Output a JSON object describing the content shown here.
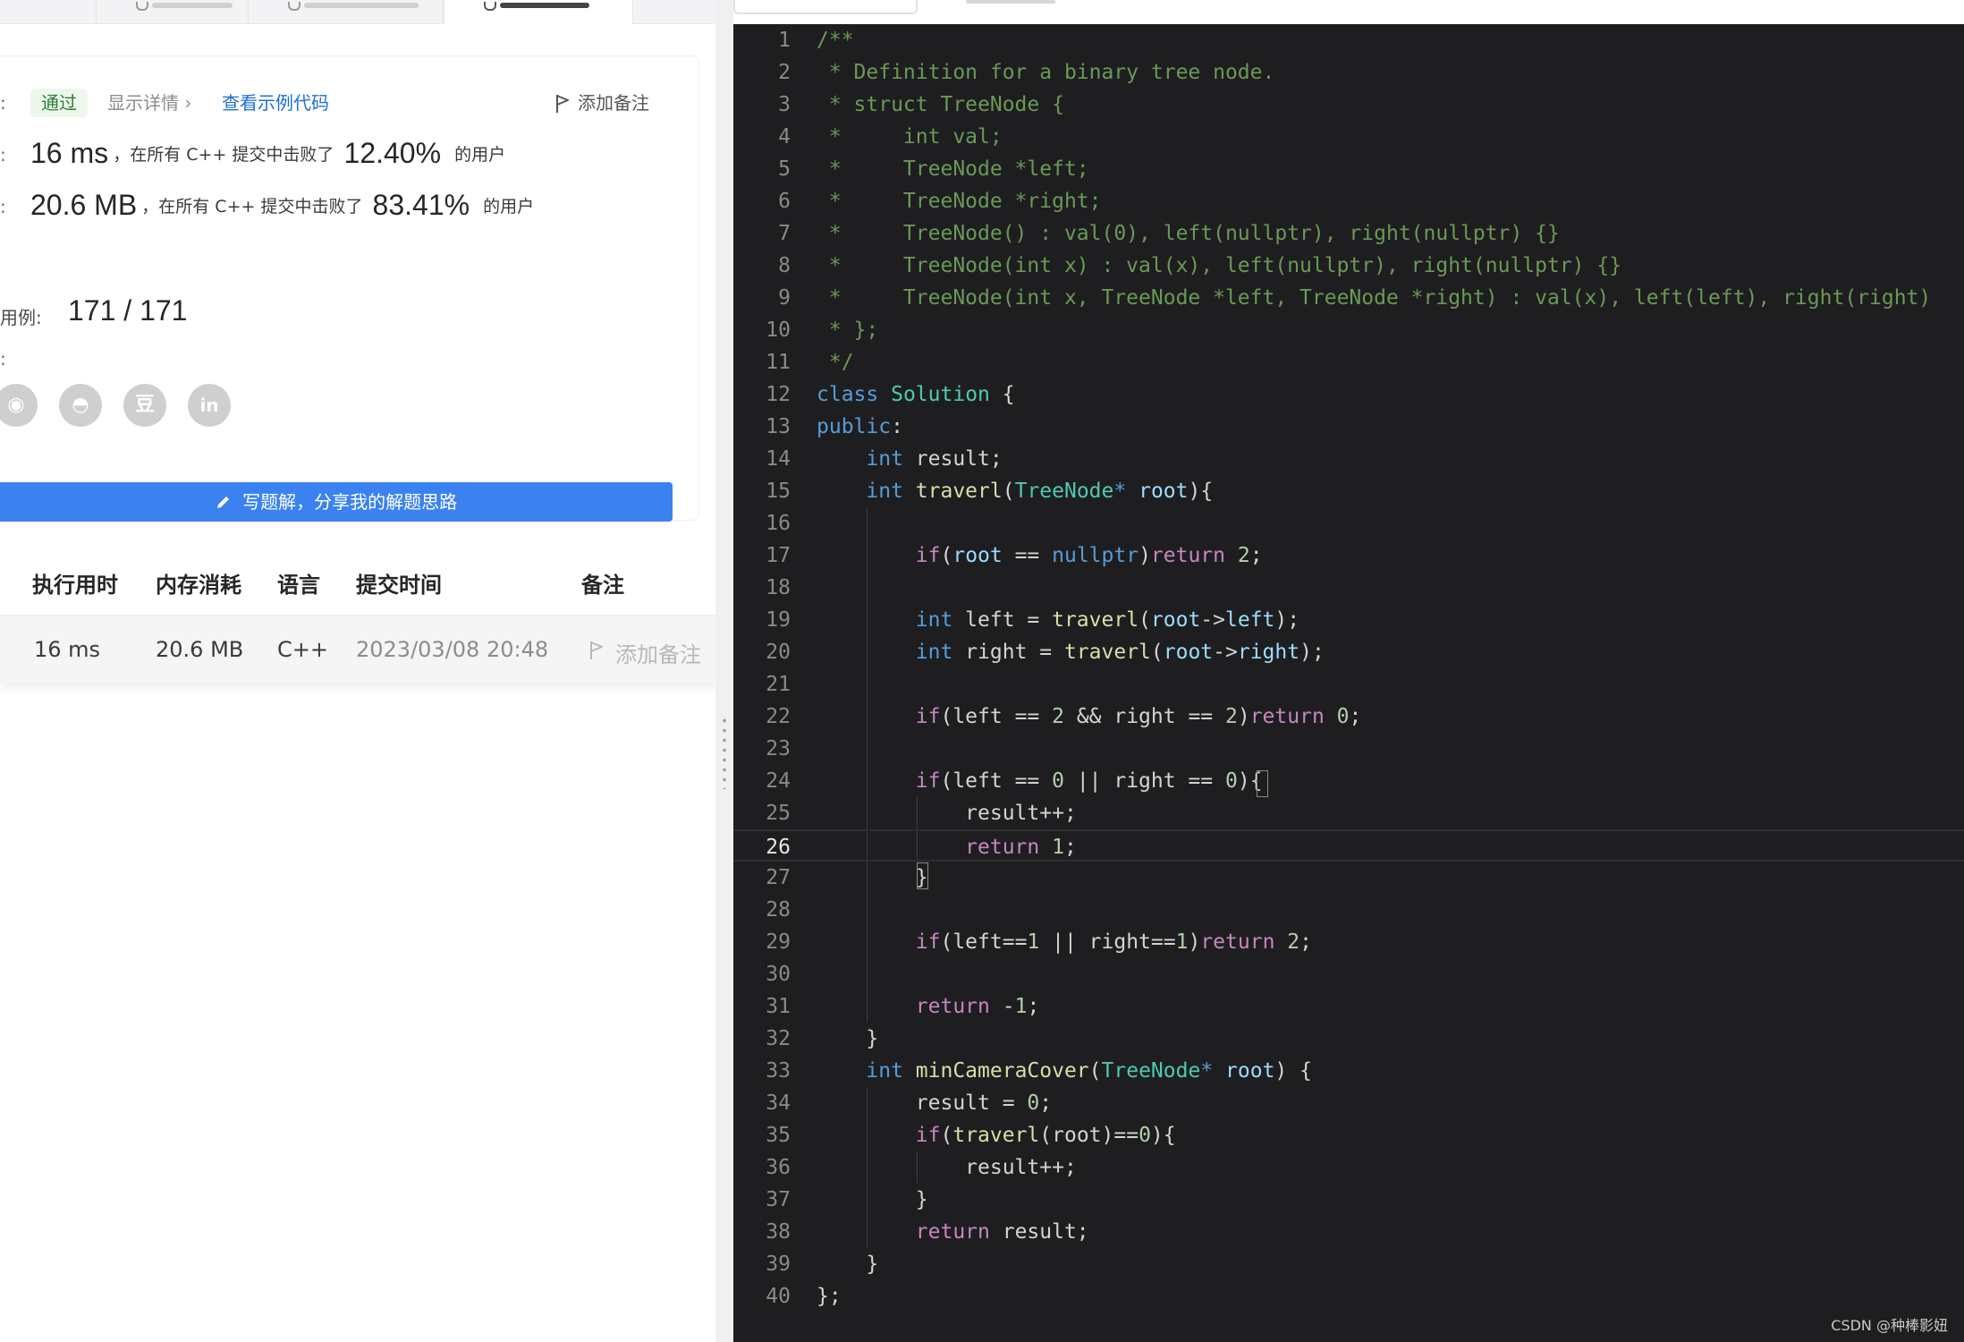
{
  "result": {
    "status_badge": "通过",
    "detail_link": "显示详情 ›",
    "sample_link": "查看示例代码",
    "add_note": "添加备注",
    "runtime": {
      "value": "16 ms",
      "text": "，在所有 C++ 提交中击败了",
      "percent": "12.40%",
      "suffix": "的用户"
    },
    "memory": {
      "value": "20.6 MB",
      "text": "，在所有 C++ 提交中击败了",
      "percent": "83.41%",
      "suffix": "的用户"
    },
    "cases_label": "用例:",
    "cases_value": "171 / 171",
    "share_icons": [
      "weibo-icon",
      "qq-icon",
      "douban-icon",
      "linkedin-icon"
    ],
    "share_glyphs": [
      "◉",
      "◓",
      "豆",
      "in"
    ],
    "write_solution_button": "写题解，分享我的解题思路"
  },
  "submissions": {
    "headers": [
      "执行用时",
      "内存消耗",
      "语言",
      "提交时间",
      "备注"
    ],
    "rows": [
      {
        "runtime": "16 ms",
        "memory": "20.6 MB",
        "language": "C++",
        "time": "2023/03/08 20:48",
        "note": "添加备注"
      }
    ]
  },
  "editor": {
    "lines": [
      [
        [
          "c",
          "/**"
        ]
      ],
      [
        [
          "c",
          " * Definition for a binary tree node."
        ]
      ],
      [
        [
          "c",
          " * struct TreeNode {"
        ]
      ],
      [
        [
          "c",
          " *     int val;"
        ]
      ],
      [
        [
          "c",
          " *     TreeNode *left;"
        ]
      ],
      [
        [
          "c",
          " *     TreeNode *right;"
        ]
      ],
      [
        [
          "c",
          " *     TreeNode() : val(0), left(nullptr), right(nullptr) {}"
        ]
      ],
      [
        [
          "c",
          " *     TreeNode(int x) : val(x), left(nullptr), right(nullptr) {}"
        ]
      ],
      [
        [
          "c",
          " *     TreeNode(int x, TreeNode *left, TreeNode *right) : val(x), left(left), right(right)"
        ]
      ],
      [
        [
          "c",
          " * };"
        ]
      ],
      [
        [
          "c",
          " */"
        ]
      ],
      [
        [
          "t",
          "class"
        ],
        [
          "o",
          " "
        ],
        [
          "k",
          "Solution"
        ],
        [
          "o",
          " {"
        ]
      ],
      [
        [
          "t",
          "public"
        ],
        [
          "o",
          ":"
        ]
      ],
      [
        [
          "o",
          "    "
        ],
        [
          "t",
          "int"
        ],
        [
          "o",
          " result;"
        ]
      ],
      [
        [
          "o",
          "    "
        ],
        [
          "t",
          "int"
        ],
        [
          "o",
          " "
        ],
        [
          "f",
          "traverl"
        ],
        [
          "o",
          "("
        ],
        [
          "k",
          "TreeNode"
        ],
        [
          "t",
          "*"
        ],
        [
          "o",
          " "
        ],
        [
          "v",
          "root"
        ],
        [
          "o",
          "){"
        ]
      ],
      [],
      [
        [
          "o",
          "        "
        ],
        [
          "w",
          "if"
        ],
        [
          "o",
          "("
        ],
        [
          "v",
          "root"
        ],
        [
          "o",
          " == "
        ],
        [
          "t",
          "nullptr"
        ],
        [
          "o",
          ")"
        ],
        [
          "w",
          "return"
        ],
        [
          "o",
          " "
        ],
        [
          "n",
          "2"
        ],
        [
          "o",
          ";"
        ]
      ],
      [],
      [
        [
          "o",
          "        "
        ],
        [
          "t",
          "int"
        ],
        [
          "o",
          " left = "
        ],
        [
          "f",
          "traverl"
        ],
        [
          "o",
          "("
        ],
        [
          "v",
          "root"
        ],
        [
          "o",
          "->"
        ],
        [
          "v",
          "left"
        ],
        [
          "o",
          ");"
        ]
      ],
      [
        [
          "o",
          "        "
        ],
        [
          "t",
          "int"
        ],
        [
          "o",
          " right = "
        ],
        [
          "f",
          "traverl"
        ],
        [
          "o",
          "("
        ],
        [
          "v",
          "root"
        ],
        [
          "o",
          "->"
        ],
        [
          "v",
          "right"
        ],
        [
          "o",
          ");"
        ]
      ],
      [],
      [
        [
          "o",
          "        "
        ],
        [
          "w",
          "if"
        ],
        [
          "o",
          "(left == "
        ],
        [
          "n",
          "2"
        ],
        [
          "o",
          " && right == "
        ],
        [
          "n",
          "2"
        ],
        [
          "o",
          ")"
        ],
        [
          "w",
          "return"
        ],
        [
          "o",
          " "
        ],
        [
          "n",
          "0"
        ],
        [
          "o",
          ";"
        ]
      ],
      [],
      [
        [
          "o",
          "        "
        ],
        [
          "w",
          "if"
        ],
        [
          "o",
          "(left == "
        ],
        [
          "n",
          "0"
        ],
        [
          "o",
          " || right == "
        ],
        [
          "n",
          "0"
        ],
        [
          "o",
          "){"
        ]
      ],
      [
        [
          "o",
          "            result++;"
        ]
      ],
      [
        [
          "o",
          "            "
        ],
        [
          "w",
          "return"
        ],
        [
          "o",
          " "
        ],
        [
          "n",
          "1"
        ],
        [
          "o",
          ";"
        ]
      ],
      [
        [
          "o",
          "        }"
        ]
      ],
      [],
      [
        [
          "o",
          "        "
        ],
        [
          "w",
          "if"
        ],
        [
          "o",
          "(left=="
        ],
        [
          "n",
          "1"
        ],
        [
          "o",
          " || right=="
        ],
        [
          "n",
          "1"
        ],
        [
          "o",
          ")"
        ],
        [
          "w",
          "return"
        ],
        [
          "o",
          " "
        ],
        [
          "n",
          "2"
        ],
        [
          "o",
          ";"
        ]
      ],
      [],
      [
        [
          "o",
          "        "
        ],
        [
          "w",
          "return"
        ],
        [
          "o",
          " -"
        ],
        [
          "n",
          "1"
        ],
        [
          "o",
          ";"
        ]
      ],
      [
        [
          "o",
          "    }"
        ]
      ],
      [
        [
          "o",
          "    "
        ],
        [
          "t",
          "int"
        ],
        [
          "o",
          " "
        ],
        [
          "f",
          "minCameraCover"
        ],
        [
          "o",
          "("
        ],
        [
          "k",
          "TreeNode"
        ],
        [
          "t",
          "*"
        ],
        [
          "o",
          " "
        ],
        [
          "v",
          "root"
        ],
        [
          "o",
          ") {"
        ]
      ],
      [
        [
          "o",
          "        result = "
        ],
        [
          "n",
          "0"
        ],
        [
          "o",
          ";"
        ]
      ],
      [
        [
          "o",
          "        "
        ],
        [
          "w",
          "if"
        ],
        [
          "o",
          "("
        ],
        [
          "f",
          "traverl"
        ],
        [
          "o",
          "(root)=="
        ],
        [
          "n",
          "0"
        ],
        [
          "o",
          "){"
        ]
      ],
      [
        [
          "o",
          "            result++;"
        ]
      ],
      [
        [
          "o",
          "        }"
        ]
      ],
      [
        [
          "o",
          "        "
        ],
        [
          "w",
          "return"
        ],
        [
          "o",
          " result;"
        ]
      ],
      [
        [
          "o",
          "    }"
        ]
      ],
      [
        [
          "o",
          "};"
        ]
      ]
    ],
    "current_line": 26
  },
  "watermark": "CSDN @种棒影妞",
  "colors": {
    "editor_bg": "#1e1e20",
    "primary_blue": "#3b82f0",
    "pass_green": "#2e7d32",
    "link_blue": "#1f6fd6"
  }
}
